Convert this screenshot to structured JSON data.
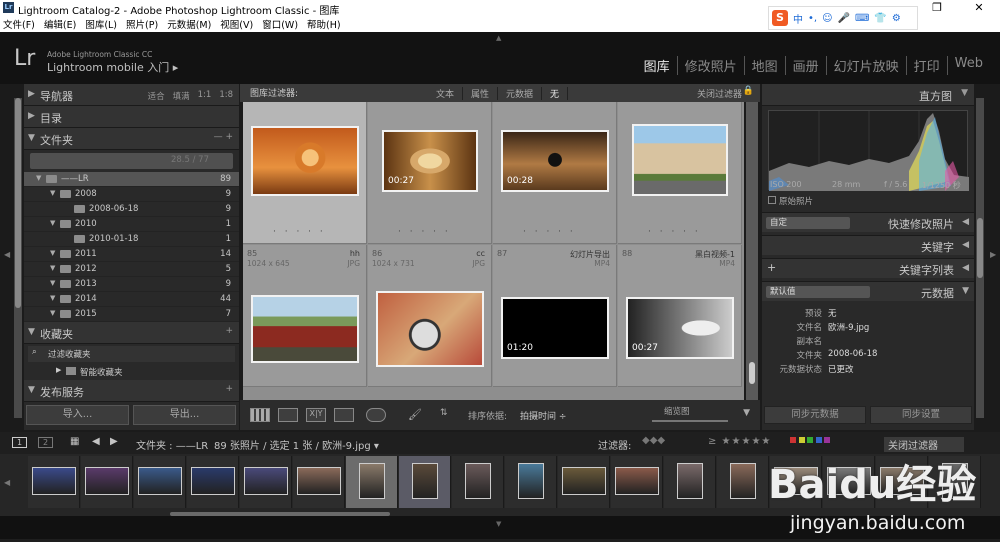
{
  "window": {
    "title": "Lightroom Catalog-2 - Adobe Photoshop Lightroom Classic - 图库",
    "app_icon": "Lr",
    "controls": [
      "—",
      "❐",
      "✕"
    ]
  },
  "menubar": [
    "文件(F)",
    "编辑(E)",
    "图库(L)",
    "照片(P)",
    "元数据(M)",
    "视图(V)",
    "窗口(W)",
    "帮助(H)"
  ],
  "ime": {
    "logo": "S",
    "mode": "中"
  },
  "identity": {
    "logo": "Lr",
    "catalog": "Adobe Lightroom Classic CC",
    "mobile": "Lightroom mobile 入门 ▸"
  },
  "modules": [
    "图库",
    "修改照片",
    "地图",
    "画册",
    "幻灯片放映",
    "打印",
    "Web"
  ],
  "left_panel": {
    "navigator": {
      "label": "导航器",
      "options": [
        "适合",
        "填满",
        "1:1",
        "1:8"
      ]
    },
    "catalog": {
      "label": "目录"
    },
    "folders": {
      "label": "文件夹",
      "actions": "—  +",
      "volume_size": "28.5 / 77"
    },
    "folder_rows": [
      {
        "name": "——LR",
        "count": "89",
        "level": 0
      },
      {
        "name": "2008",
        "count": "9",
        "level": 1
      },
      {
        "name": "2008-06-18",
        "count": "9",
        "level": 2
      },
      {
        "name": "2010",
        "count": "1",
        "level": 1
      },
      {
        "name": "2010-01-18",
        "count": "1",
        "level": 2
      },
      {
        "name": "2011",
        "count": "14",
        "level": 1
      },
      {
        "name": "2012",
        "count": "5",
        "level": 1
      },
      {
        "name": "2013",
        "count": "9",
        "level": 1
      },
      {
        "name": "2014",
        "count": "44",
        "level": 1
      },
      {
        "name": "2015",
        "count": "7",
        "level": 1
      }
    ],
    "collections": {
      "label": "收藏夹",
      "plus": "+",
      "filter": "过滤收藏夹",
      "smart": "智能收藏夹"
    },
    "publish": {
      "label": "发布服务",
      "plus": "+"
    },
    "import_label": "导入...",
    "export_label": "导出..."
  },
  "filter_bar": {
    "label": "图库过滤器:",
    "tabs": [
      "文本",
      "属性",
      "元数据",
      "无"
    ],
    "off": "关闭过滤器"
  },
  "grid_cells": [
    {
      "num": "",
      "name": "",
      "dim": "",
      "ext": "",
      "duration": "",
      "selected": true
    },
    {
      "num": "",
      "name": "",
      "dim": "",
      "ext": "",
      "duration": "00:27",
      "selected": false
    },
    {
      "num": "",
      "name": "",
      "dim": "",
      "ext": "",
      "duration": "00:28",
      "selected": false
    },
    {
      "num": "",
      "name": "",
      "dim": "",
      "ext": "",
      "duration": "",
      "selected": false
    },
    {
      "num": "85",
      "name": "hh",
      "dim": "1024 x 645",
      "ext": "JPG",
      "duration": "",
      "selected": false
    },
    {
      "num": "86",
      "name": "cc",
      "dim": "1024 x 731",
      "ext": "JPG",
      "duration": "",
      "selected": false
    },
    {
      "num": "87",
      "name": "幻灯片导出",
      "dim": "",
      "ext": "MP4",
      "duration": "01:20",
      "selected": false
    },
    {
      "num": "88",
      "name": "黑白视频-1",
      "dim": "",
      "ext": "MP4",
      "duration": "00:27",
      "selected": false
    }
  ],
  "toolbar": {
    "sort_label": "排序依据:",
    "sort_value": "拍摄时间 ÷",
    "thumb_label": "缩览图"
  },
  "right_panel": {
    "histogram_label": "直方图",
    "exif": [
      "ISO 200",
      "28 mm",
      "f / 5.6",
      "1/1250 秒"
    ],
    "original_photo": "原始照片",
    "quick_develop": {
      "preset": "自定",
      "label": "快速修改照片"
    },
    "keywords": "关键字",
    "keyword_list": "关键字列表",
    "metadata": {
      "preset": "默认值",
      "label": "元数据"
    },
    "metadata_rows": [
      {
        "key": "预设",
        "value": "无"
      },
      {
        "key": "文件名",
        "value": "欧洲-9.jpg"
      },
      {
        "key": "副本名",
        "value": ""
      },
      {
        "key": "文件夹",
        "value": "2008-06-18"
      },
      {
        "key": "元数据状态",
        "value": "已更改"
      }
    ],
    "sync_metadata": "同步元数据",
    "sync_settings": "同步设置"
  },
  "filmstrip_bar": {
    "pages": [
      "1",
      "2"
    ],
    "source": "文件夹 : ——LR",
    "counts": "89 张照片 / 选定 1 张 / 欧洲-9.jpg ▾",
    "filter_label": "过滤器:",
    "filter_off": "关闭过滤器"
  },
  "watermark": {
    "brand": "Baidu经验",
    "url": "jingyan.baidu.com"
  },
  "colors": {
    "accent": "#f05a23",
    "panel": "#292929",
    "grid": "#8e8e8e"
  }
}
